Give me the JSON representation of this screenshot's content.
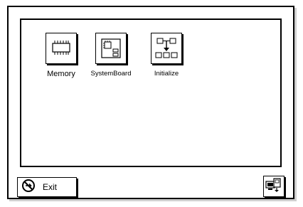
{
  "main": {
    "items": [
      {
        "label": "Memory",
        "icon": "memory-chip-icon"
      },
      {
        "label": "SystemBoard",
        "icon": "system-board-icon"
      },
      {
        "label": "Initialize",
        "icon": "initialize-icon"
      }
    ]
  },
  "footer": {
    "exit_label": "Exit",
    "exit_icon": "no-entry-icon",
    "pc_icon": "computer-icon"
  }
}
